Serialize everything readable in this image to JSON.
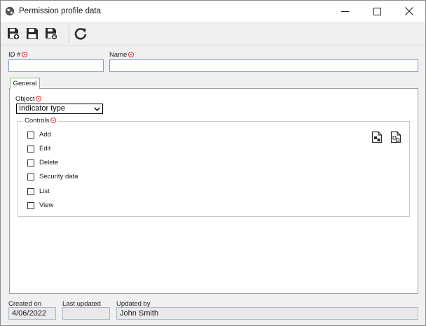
{
  "window": {
    "title": "Permission profile data",
    "controls": {
      "minimize": "minimize",
      "maximize": "maximize",
      "close": "close"
    }
  },
  "toolbar": {
    "buttons": [
      {
        "name": "save-new",
        "icon": "save-plus-icon"
      },
      {
        "name": "save",
        "icon": "save-icon"
      },
      {
        "name": "save-close",
        "icon": "save-close-icon"
      },
      {
        "name": "refresh",
        "icon": "refresh-icon"
      }
    ]
  },
  "form": {
    "id_label": "ID #",
    "id_value": "",
    "name_label": "Name",
    "name_value": ""
  },
  "tabs": [
    {
      "label": "General",
      "active": true
    }
  ],
  "general": {
    "object_label": "Object",
    "object_value": "Indicator type",
    "controls_label": "Controls",
    "controls": [
      {
        "label": "Add",
        "checked": false
      },
      {
        "label": "Edit",
        "checked": false
      },
      {
        "label": "Delete",
        "checked": false
      },
      {
        "label": "Security data",
        "checked": false
      },
      {
        "label": "List",
        "checked": false
      },
      {
        "label": "View",
        "checked": false
      }
    ]
  },
  "footer": {
    "created_on_label": "Created on",
    "created_on_value": "4/06/2022",
    "last_updated_label": "Last updated",
    "last_updated_value": "",
    "updated_by_label": "Updated by",
    "updated_by_value": "John Smith"
  },
  "colors": {
    "required": "#e03131",
    "field_border": "#7a9cc6",
    "active_tab_border": "#7fba6e"
  }
}
